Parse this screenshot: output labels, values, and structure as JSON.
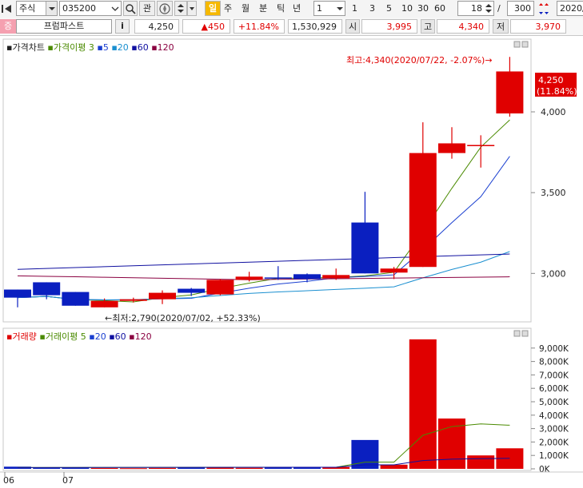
{
  "toolbar": {
    "market_select": "주식",
    "stock_code": "035200",
    "btn_related": "관",
    "period_buttons": [
      "일",
      "주",
      "월",
      "분",
      "틱",
      "년"
    ],
    "unit_value": "1",
    "quick_buttons": [
      "1",
      "3",
      "5",
      "10",
      "30",
      "60"
    ],
    "view_count": "18",
    "total_count": "300",
    "date_field": "2020/"
  },
  "quote": {
    "badge": "증",
    "stock_name": "프럼파스트",
    "info_btn": "i",
    "price": "4,250",
    "change": "▲450",
    "change_pct": "+11.84%",
    "volume": "1,530,929",
    "open_label": "시",
    "open": "3,995",
    "high_label": "고",
    "high": "4,340",
    "low_label": "저",
    "low": "3,970"
  },
  "price_legend": [
    {
      "text": "가격차트",
      "color": "#222222"
    },
    {
      "text": "가격이평 3",
      "color": "#4a8a00"
    },
    {
      "text": "5",
      "color": "#1a3fd0"
    },
    {
      "text": "20",
      "color": "#1a8fd0"
    },
    {
      "text": "60",
      "color": "#1010a0"
    },
    {
      "text": "120",
      "color": "#8a0040"
    }
  ],
  "volume_legend": [
    {
      "text": "거래량",
      "color": "#e00000"
    },
    {
      "text": "거래이평 5",
      "color": "#4a8a00"
    },
    {
      "text": "20",
      "color": "#1a3fd0"
    },
    {
      "text": "60",
      "color": "#1010a0"
    },
    {
      "text": "120",
      "color": "#8a0040"
    }
  ],
  "annotations": {
    "high_note": "최고:4,340(2020/07/22, -2.07%)→",
    "low_note": "←최저:2,790(2020/07/02, +52.33%)",
    "current_price": "4,250",
    "current_pct": "(11.84%)"
  },
  "price_axis": [
    "4,000",
    "3,500",
    "3,000"
  ],
  "volume_axis": [
    "9,000K",
    "8,000K",
    "7,000K",
    "6,000K",
    "5,000K",
    "4,000K",
    "3,000K",
    "2,000K",
    "1,000K",
    "0K"
  ],
  "x_axis": [
    "06",
    "07"
  ],
  "colors": {
    "up": "#e00000",
    "down": "#0a1fc0",
    "ma3": "#4a8a00",
    "ma5": "#1a3fd0",
    "ma20": "#1a8fd0",
    "ma60": "#1010a0",
    "ma120": "#8a0040"
  },
  "chart_data": {
    "type": "candlestick",
    "price_ylim": [
      2700,
      4450
    ],
    "candles": [
      {
        "open": 2900,
        "close": 2850,
        "high": 2900,
        "low": 2790
      },
      {
        "open": 2945,
        "close": 2865,
        "high": 2945,
        "low": 2840
      },
      {
        "open": 2885,
        "close": 2800,
        "high": 2885,
        "low": 2800
      },
      {
        "open": 2790,
        "close": 2830,
        "high": 2845,
        "low": 2790
      },
      {
        "open": 2830,
        "close": 2840,
        "high": 2850,
        "low": 2820
      },
      {
        "open": 2840,
        "close": 2880,
        "high": 2895,
        "low": 2810
      },
      {
        "open": 2905,
        "close": 2880,
        "high": 2910,
        "low": 2860
      },
      {
        "open": 2870,
        "close": 2960,
        "high": 2965,
        "low": 2865
      },
      {
        "open": 2960,
        "close": 2980,
        "high": 3010,
        "low": 2950
      },
      {
        "open": 2975,
        "close": 2970,
        "high": 3045,
        "low": 2960
      },
      {
        "open": 2995,
        "close": 2965,
        "high": 3000,
        "low": 2945
      },
      {
        "open": 2970,
        "close": 2990,
        "high": 3030,
        "low": 2960
      },
      {
        "open": 3315,
        "close": 3000,
        "high": 3505,
        "low": 3000
      },
      {
        "open": 3005,
        "close": 3030,
        "high": 3040,
        "low": 2965
      },
      {
        "open": 3040,
        "close": 3745,
        "high": 3935,
        "low": 3040
      },
      {
        "open": 3745,
        "close": 3805,
        "high": 3905,
        "low": 3710
      },
      {
        "open": 3795,
        "close": 3795,
        "high": 3855,
        "low": 3655
      },
      {
        "open": 3990,
        "close": 4250,
        "high": 4340,
        "low": 3970
      }
    ],
    "volume_ylim": [
      0,
      10000
    ],
    "volume": [
      160,
      90,
      100,
      60,
      50,
      70,
      120,
      90,
      80,
      100,
      110,
      140,
      2150,
      310,
      9650,
      3750,
      1000,
      1530
    ],
    "ma_vol5": [
      null,
      null,
      null,
      null,
      null,
      null,
      null,
      null,
      null,
      null,
      null,
      null,
      500,
      500,
      2500,
      3150,
      3350,
      3250
    ],
    "ma_vol_long": [
      null,
      null,
      null,
      null,
      null,
      null,
      null,
      null,
      null,
      null,
      null,
      null,
      300,
      300,
      620,
      720,
      760,
      780
    ]
  }
}
